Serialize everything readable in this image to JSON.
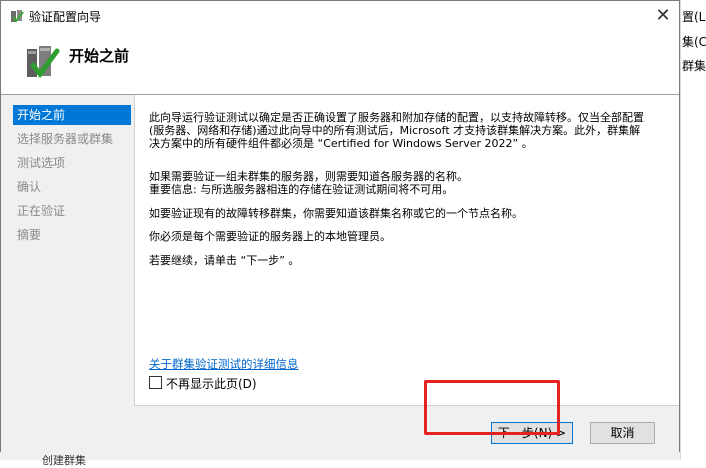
{
  "background_app": {
    "items": [
      "置(L)",
      "集(C)",
      "群集"
    ],
    "bottom_text": "创建群集"
  },
  "window": {
    "title": "验证配置向导",
    "close_label": "✕",
    "header_title": "开始之前"
  },
  "nav": {
    "items": [
      {
        "label": "开始之前",
        "active": true
      },
      {
        "label": "选择服务器或群集",
        "active": false
      },
      {
        "label": "测试选项",
        "active": false
      },
      {
        "label": "确认",
        "active": false
      },
      {
        "label": "正在验证",
        "active": false
      },
      {
        "label": "摘要",
        "active": false
      }
    ]
  },
  "content": {
    "paragraphs": [
      "此向导运行验证测试以确定是否正确设置了服务器和附加存储的配置，以支持故障转移。仅当全部配置(服务器、网络和存储)通过此向导中的所有测试后，Microsoft 才支持该群集解决方案。此外，群集解决方案中的所有硬件组件都必须是 “Certified for Windows Server 2022” 。",
      "如果需要验证一组未群集的服务器，则需要知道各服务器的名称。",
      "重要信息: 与所选服务器相连的存储在验证测试期间将不可用。",
      "如要验证现有的故障转移群集，你需要知道该群集名称或它的一个节点名称。",
      "你必须是每个需要验证的服务器上的本地管理员。",
      "若要继续，请单击 “下一步” 。"
    ],
    "link": "关于群集验证测试的详细信息",
    "checkbox_label": "不再显示此页(D)",
    "checkbox_checked": false
  },
  "buttons": {
    "next": "下一步(N) >",
    "cancel": "取消"
  },
  "colors": {
    "accent": "#0078d7",
    "highlight": "#e32222",
    "link": "#0066cc"
  }
}
